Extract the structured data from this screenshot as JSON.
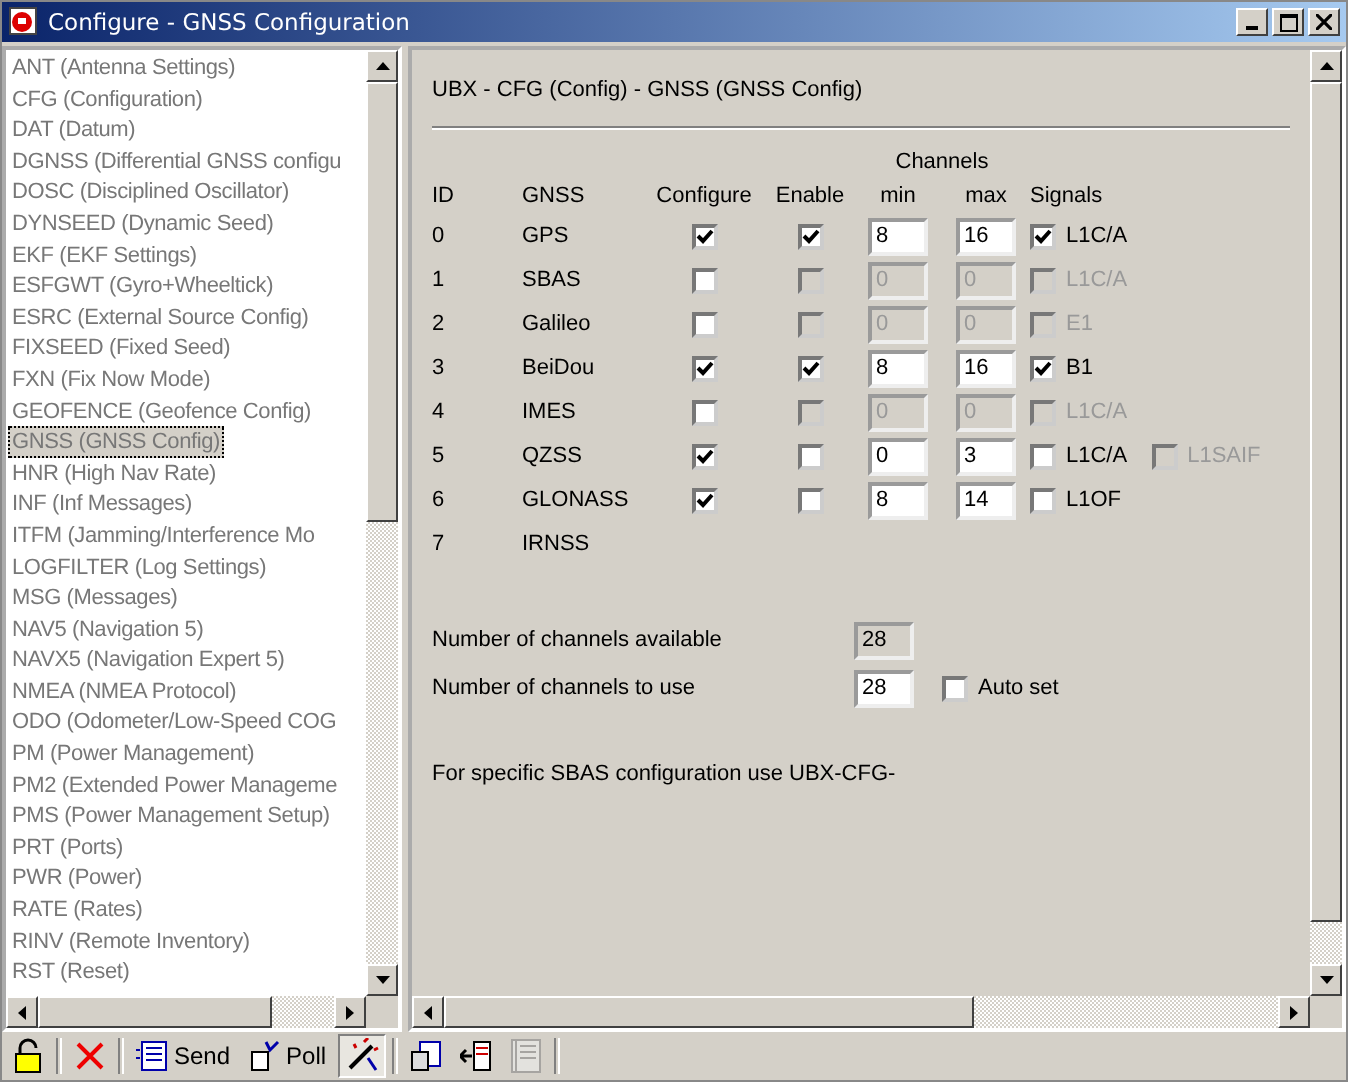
{
  "window": {
    "title": "Configure - GNSS Configuration"
  },
  "sidebar": {
    "items": [
      {
        "label": "ANT (Antenna Settings)",
        "selected": false
      },
      {
        "label": "CFG (Configuration)",
        "selected": false
      },
      {
        "label": "DAT (Datum)",
        "selected": false
      },
      {
        "label": "DGNSS (Differential GNSS configu",
        "selected": false
      },
      {
        "label": "DOSC (Disciplined Oscillator)",
        "selected": false
      },
      {
        "label": "DYNSEED (Dynamic Seed)",
        "selected": false
      },
      {
        "label": "EKF (EKF Settings)",
        "selected": false
      },
      {
        "label": "ESFGWT (Gyro+Wheeltick)",
        "selected": false
      },
      {
        "label": "ESRC (External Source Config)",
        "selected": false
      },
      {
        "label": "FIXSEED (Fixed Seed)",
        "selected": false
      },
      {
        "label": "FXN (Fix Now Mode)",
        "selected": false
      },
      {
        "label": "GEOFENCE (Geofence Config)",
        "selected": false
      },
      {
        "label": "GNSS (GNSS Config)",
        "selected": true
      },
      {
        "label": "HNR (High Nav Rate)",
        "selected": false
      },
      {
        "label": "INF (Inf Messages)",
        "selected": false
      },
      {
        "label": "ITFM (Jamming/Interference Mo",
        "selected": false
      },
      {
        "label": "LOGFILTER (Log Settings)",
        "selected": false
      },
      {
        "label": "MSG (Messages)",
        "selected": false
      },
      {
        "label": "NAV5 (Navigation 5)",
        "selected": false
      },
      {
        "label": "NAVX5 (Navigation Expert 5)",
        "selected": false
      },
      {
        "label": "NMEA (NMEA Protocol)",
        "selected": false
      },
      {
        "label": "ODO (Odometer/Low-Speed COG",
        "selected": false
      },
      {
        "label": "PM (Power Management)",
        "selected": false
      },
      {
        "label": "PM2 (Extended Power Manageme",
        "selected": false
      },
      {
        "label": "PMS (Power Management Setup)",
        "selected": false
      },
      {
        "label": "PRT (Ports)",
        "selected": false
      },
      {
        "label": "PWR (Power)",
        "selected": false
      },
      {
        "label": "RATE (Rates)",
        "selected": false
      },
      {
        "label": "RINV (Remote Inventory)",
        "selected": false
      },
      {
        "label": "RST (Reset)",
        "selected": false
      }
    ]
  },
  "panel": {
    "title": "UBX - CFG (Config) - GNSS (GNSS Config)",
    "group_header": "Channels",
    "columns": [
      "ID",
      "GNSS",
      "Configure",
      "Enable",
      "min",
      "max",
      "Signals"
    ],
    "rows": [
      {
        "kind": "full",
        "id": "0",
        "gnss": "GPS",
        "configure": true,
        "enable": true,
        "enable_disabled": false,
        "min": "8",
        "max": "16",
        "fields_disabled": false,
        "signals": [
          {
            "label": "L1C/A",
            "checked": true,
            "disabled": false
          }
        ]
      },
      {
        "kind": "full",
        "id": "1",
        "gnss": "SBAS",
        "configure": false,
        "enable": false,
        "enable_disabled": true,
        "min": "0",
        "max": "0",
        "fields_disabled": true,
        "signals": [
          {
            "label": "L1C/A",
            "checked": false,
            "disabled": true
          }
        ]
      },
      {
        "kind": "full",
        "id": "2",
        "gnss": "Galileo",
        "configure": false,
        "enable": false,
        "enable_disabled": true,
        "min": "0",
        "max": "0",
        "fields_disabled": true,
        "signals": [
          {
            "label": "E1",
            "checked": false,
            "disabled": true
          }
        ]
      },
      {
        "kind": "full",
        "id": "3",
        "gnss": "BeiDou",
        "configure": true,
        "enable": true,
        "enable_disabled": false,
        "min": "8",
        "max": "16",
        "fields_disabled": false,
        "signals": [
          {
            "label": "B1",
            "checked": true,
            "disabled": false
          }
        ]
      },
      {
        "kind": "full",
        "id": "4",
        "gnss": "IMES",
        "configure": false,
        "enable": false,
        "enable_disabled": true,
        "min": "0",
        "max": "0",
        "fields_disabled": true,
        "signals": [
          {
            "label": "L1C/A",
            "checked": false,
            "disabled": true
          }
        ]
      },
      {
        "kind": "full",
        "id": "5",
        "gnss": "QZSS",
        "configure": true,
        "enable": false,
        "enable_disabled": false,
        "min": "0",
        "max": "3",
        "fields_disabled": false,
        "signals": [
          {
            "label": "L1C/A",
            "checked": false,
            "disabled": false
          },
          {
            "label": "L1SAIF",
            "checked": false,
            "disabled": true
          }
        ]
      },
      {
        "kind": "full",
        "id": "6",
        "gnss": "GLONASS",
        "configure": true,
        "enable": false,
        "enable_disabled": false,
        "min": "8",
        "max": "14",
        "fields_disabled": false,
        "signals": [
          {
            "label": "L1OF",
            "checked": false,
            "disabled": false
          }
        ]
      },
      {
        "kind": "plain",
        "id": "7",
        "gnss": "IRNSS"
      }
    ],
    "available_label": "Number of channels available",
    "available": "28",
    "use_label": "Number of channels to use",
    "use": "28",
    "auto_set": {
      "label": "Auto set",
      "checked": false
    },
    "note": "For specific SBAS configuration use UBX-CFG-"
  },
  "toolbar": {
    "send": "Send",
    "poll": "Poll",
    "toggle_pressed": true
  }
}
